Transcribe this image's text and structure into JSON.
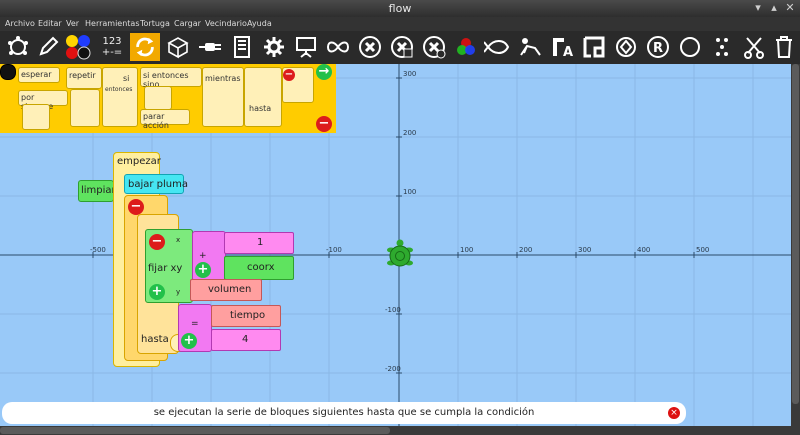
{
  "window": {
    "title": "flow"
  },
  "menu": [
    "Archivo",
    "Editar",
    "Ver",
    "Herramientas",
    "Tortuga",
    "Cargar",
    "Vecindario",
    "Ayuda"
  ],
  "toolbar": {
    "number_label_top": "123",
    "number_label_bottom": "+-=",
    "icons": [
      "turtle-icon",
      "pen-icon",
      "colors-icon",
      "numbers-icon",
      "flow-icon",
      "boxes-icon",
      "sensors-icon",
      "media-icon",
      "extras-icon",
      "presentation-icon",
      "infinity-icon",
      "stop-icon",
      "clear-icon",
      "erase-icon",
      "palette-icon",
      "fish-icon",
      "reclining-icon",
      "label-icon",
      "frame-icon",
      "save-icon",
      "register-icon",
      "circle-icon",
      "dots-icon",
      "cut-icon",
      "trash-icon"
    ]
  },
  "palette": {
    "blocks": {
      "wait": "esperar",
      "forever": "por siempre",
      "repeat": "repetir",
      "if": "si",
      "then": "entonces",
      "ifelse": "si entonces sino",
      "stopaction": "parar acción",
      "while": "mientras",
      "until": "hasta"
    }
  },
  "canvas": {
    "x_ticks": [
      "-500",
      "-100",
      "100",
      "200",
      "300",
      "400",
      "500"
    ],
    "y_ticks": [
      "300",
      "200",
      "100",
      "-100",
      "-200"
    ]
  },
  "program": {
    "start": "empezar",
    "clear": "limpiar",
    "pen_down": "bajar pluma",
    "set_xy": "fijar xy",
    "x_arg": "x",
    "y_arg": "y",
    "plus": "+",
    "equals": "=",
    "num_one": "1",
    "xcor": "coorx",
    "volume": "volumen",
    "time": "tiempo",
    "num_four": "4",
    "until": "hasta"
  },
  "help": {
    "text": "se ejecutan la serie de bloques siguientes hasta que se cumpla la condición"
  },
  "colors": {
    "turtle": "#2eaa2e",
    "palette": "#ffcc00",
    "canvas": "#99c9f8",
    "toolbar": "#2a2a2a"
  }
}
